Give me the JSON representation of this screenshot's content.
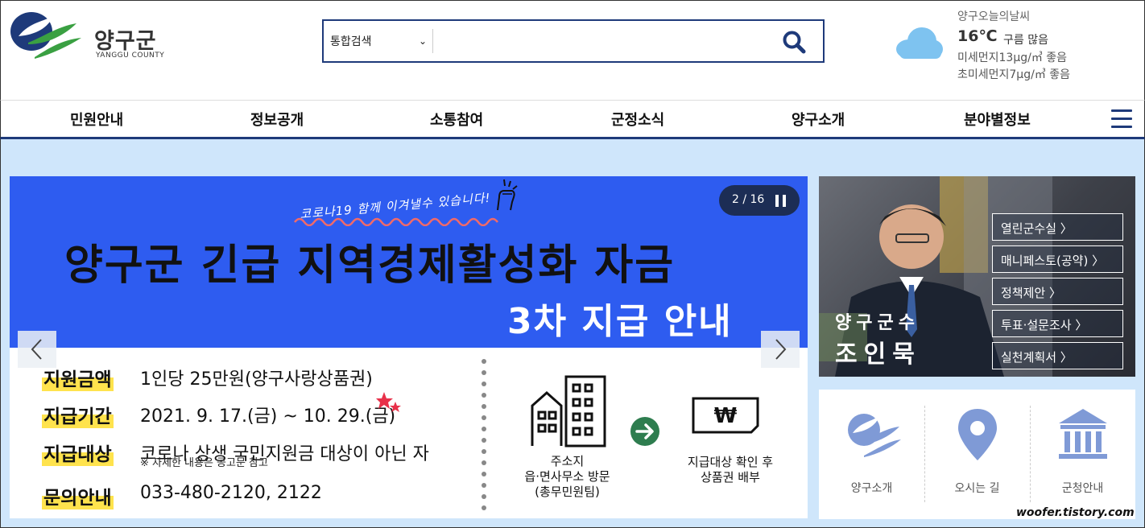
{
  "header": {
    "logo_text": "양구군",
    "logo_sub": "YANGGU COUNTY",
    "search": {
      "category": "통합검색",
      "placeholder": ""
    },
    "weather": {
      "title": "양구오늘의날씨",
      "temp": "16℃",
      "condition": "구름 많음",
      "pm10": "미세먼지13μg/㎥ 좋음",
      "pm25": "초미세먼지7μg/㎥ 좋음",
      "icon": "cloud-icon",
      "icon_color": "#7ec3f0"
    }
  },
  "nav": {
    "items": [
      "민원안내",
      "정보공개",
      "소통참여",
      "군정소식",
      "양구소개",
      "분야별정보"
    ],
    "menu_icon": "hamburger-icon"
  },
  "banner": {
    "slogan": "코로나19 함께 이겨낼수 있습니다!",
    "headline": "양구군 긴급 지역경제활성화 자금",
    "headline2": "3차 지급 안내",
    "pager": "2 / 16",
    "rows": [
      {
        "label": "지원금액",
        "value": "1인당 25만원(양구사랑상품권)"
      },
      {
        "label": "지급기간",
        "value": "2021. 9. 17.(금) ~ 10. 29.(금)"
      },
      {
        "label": "지급대상",
        "value": "코로나 상생 국민지원금 대상이 아닌 자"
      },
      {
        "label": "문의안내",
        "value": "033-480-2120, 2122"
      }
    ],
    "note": "※ 자세한 내용은 공고문 참고",
    "flow_left": [
      "주소지",
      "읍·면사무소 방문",
      "(총무민원팀)"
    ],
    "flow_right": [
      "지급대상 확인 후",
      "상품권 배부"
    ],
    "colors": {
      "top": "#2e5cf0",
      "highlight": "#ffe34d"
    }
  },
  "mayor": {
    "title": "양구군수",
    "name": "조인묵",
    "links": [
      "열린군수실 〉",
      "매니페스토(공약) 〉",
      "정책제안 〉",
      "투표·설문조사 〉",
      "실천계획서 〉"
    ]
  },
  "quick": [
    {
      "label": "양구소개",
      "icon": "county-logo-icon"
    },
    {
      "label": "오시는 길",
      "icon": "location-pin-icon"
    },
    {
      "label": "군청안내",
      "icon": "government-building-icon"
    }
  ],
  "watermark": "woofer.tistory.com"
}
